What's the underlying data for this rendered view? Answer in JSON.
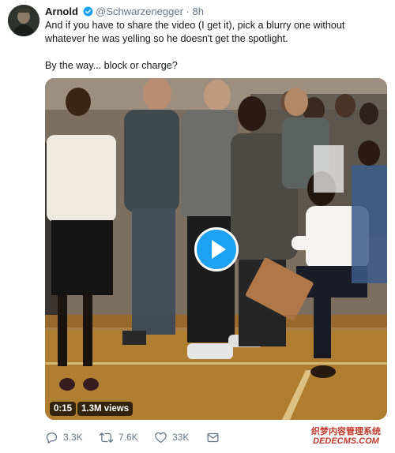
{
  "tweet": {
    "author_name": "Arnold",
    "handle": "@Schwarzenegger",
    "separator": "·",
    "time": "8h",
    "text_line1": "And if you have to share the video (I get it), pick a blurry one without whatever he was yelling so he doesn't get the spotlight.",
    "text_line2": "By the way... block or charge?"
  },
  "video": {
    "duration": "0:15",
    "views": "1.3M views",
    "play_icon": "play-icon"
  },
  "actions": {
    "reply_count": "3.3K",
    "retweet_count": "7.6K",
    "like_count": "33K",
    "icons": [
      "reply-icon",
      "retweet-icon",
      "like-icon",
      "direct-message-icon"
    ]
  },
  "watermark": {
    "line1": "织梦内容管理系统",
    "line2": "DEDECMS.COM"
  },
  "colors": {
    "brand_blue": "#1da1f2",
    "text_primary": "#14171a",
    "text_secondary": "#657786",
    "watermark_red": "#c0392b"
  }
}
